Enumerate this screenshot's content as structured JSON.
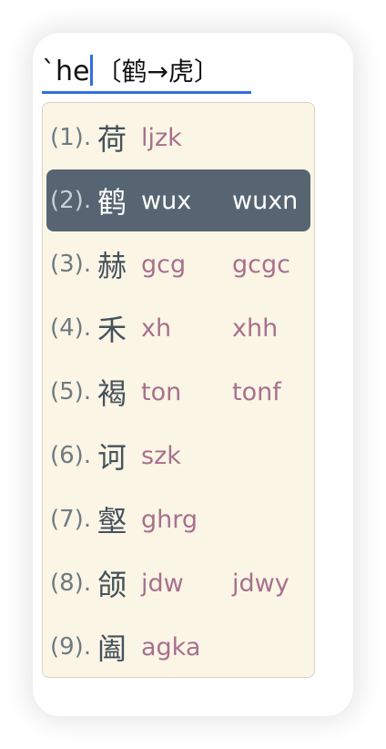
{
  "preedit": {
    "typed": "`he",
    "hint": "〔鹤→虎〕"
  },
  "candidates": [
    {
      "index": "(1).",
      "hanzi": "荷",
      "code": "ljzk",
      "code_full": ""
    },
    {
      "index": "(2).",
      "hanzi": "鹤",
      "code": "wux",
      "code_full": "wuxn"
    },
    {
      "index": "(3).",
      "hanzi": "赫",
      "code": "gcg",
      "code_full": "gcgc"
    },
    {
      "index": "(4).",
      "hanzi": "禾",
      "code": "xh",
      "code_full": "xhh"
    },
    {
      "index": "(5).",
      "hanzi": "褐",
      "code": "ton",
      "code_full": "tonf"
    },
    {
      "index": "(6).",
      "hanzi": "诃",
      "code": "szk",
      "code_full": ""
    },
    {
      "index": "(7).",
      "hanzi": "壑",
      "code": "ghrg",
      "code_full": ""
    },
    {
      "index": "(8).",
      "hanzi": "颌",
      "code": "jdw",
      "code_full": "jdwy"
    },
    {
      "index": "(9).",
      "hanzi": "阖",
      "code": "agka",
      "code_full": ""
    }
  ],
  "selected_index": 2,
  "colors": {
    "panel_bg": "#fbf5e6",
    "highlight_bg": "#566571",
    "code_text": "#a8708c",
    "caret_underline": "#2f6fe0"
  }
}
